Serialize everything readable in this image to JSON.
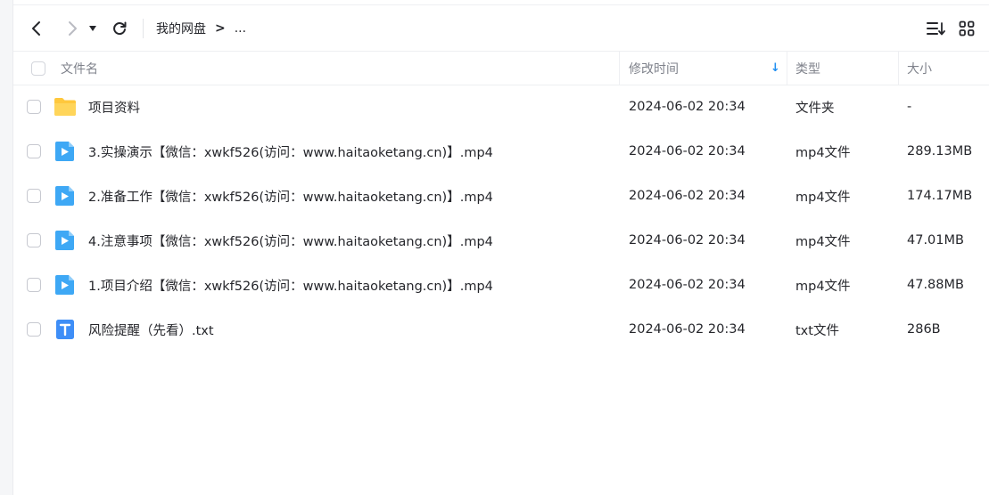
{
  "breadcrumb": {
    "root": "我的网盘",
    "separator": ">",
    "more": "..."
  },
  "header": {
    "name": "文件名",
    "modified": "修改时间",
    "sort_arrow": "↓",
    "type": "类型",
    "size": "大小"
  },
  "files": [
    {
      "icon": "folder-icon",
      "name": "项目资料",
      "modified": "2024-06-02 20:34",
      "type": "文件夹",
      "size": "-"
    },
    {
      "icon": "video-file-icon",
      "name": "3.实操演示【微信：xwkf526(访问：www.haitaoketang.cn)】.mp4",
      "modified": "2024-06-02 20:34",
      "type": "mp4文件",
      "size": "289.13MB"
    },
    {
      "icon": "video-file-icon",
      "name": "2.准备工作【微信：xwkf526(访问：www.haitaoketang.cn)】.mp4",
      "modified": "2024-06-02 20:34",
      "type": "mp4文件",
      "size": "174.17MB"
    },
    {
      "icon": "video-file-icon",
      "name": "4.注意事项【微信：xwkf526(访问：www.haitaoketang.cn)】.mp4",
      "modified": "2024-06-02 20:34",
      "type": "mp4文件",
      "size": "47.01MB"
    },
    {
      "icon": "video-file-icon",
      "name": "1.项目介绍【微信：xwkf526(访问：www.haitaoketang.cn)】.mp4",
      "modified": "2024-06-02 20:34",
      "type": "mp4文件",
      "size": "47.88MB"
    },
    {
      "icon": "text-file-icon",
      "name": "风险提醒（先看）.txt",
      "modified": "2024-06-02 20:34",
      "type": "txt文件",
      "size": "286B"
    }
  ],
  "colors": {
    "accent": "#1f8ef1",
    "folder": "#ffc83d",
    "video": "#3ea8f5",
    "text_file": "#3e8ef7",
    "muted": "#7f828b"
  }
}
